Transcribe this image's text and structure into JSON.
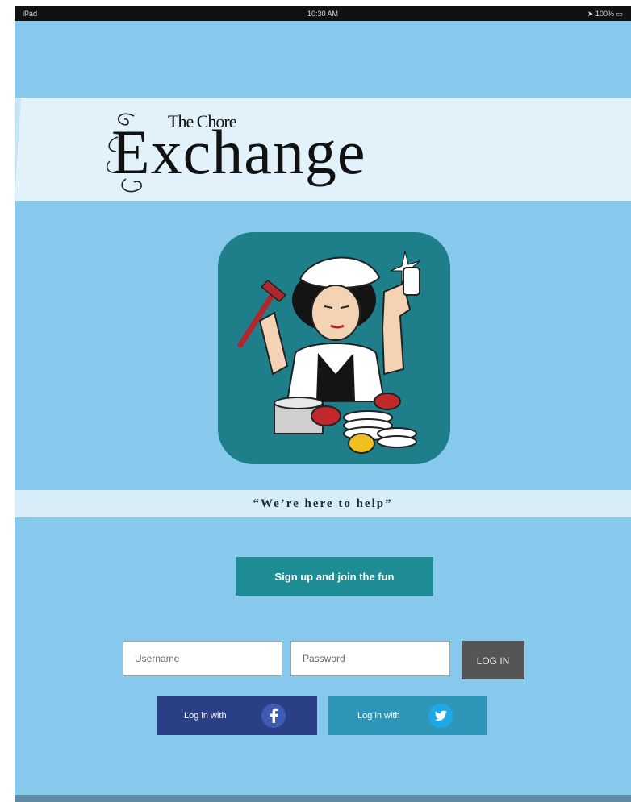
{
  "status_bar": {
    "left": "iPad",
    "time": "10:30 AM",
    "battery": "100%"
  },
  "logo": {
    "small_text": "The Chore",
    "big_text": "Exchange"
  },
  "tagline": "“We’re here to help”",
  "signup": {
    "label": "Sign up and join the fun"
  },
  "login": {
    "username_placeholder": "Username",
    "password_placeholder": "Password",
    "button_label": "LOG IN"
  },
  "social": {
    "facebook_label": "Log in with",
    "twitter_label": "Log in with"
  },
  "icons": {
    "facebook": "facebook-icon",
    "twitter": "twitter-icon",
    "wifi": "wifi-icon",
    "battery": "battery-icon"
  },
  "colors": {
    "background": "#86c9ec",
    "banner": "#e1f2fb",
    "teal": "#1e8c95",
    "login_button": "#555555",
    "facebook": "#2b3f86",
    "twitter": "#2e97b9"
  }
}
